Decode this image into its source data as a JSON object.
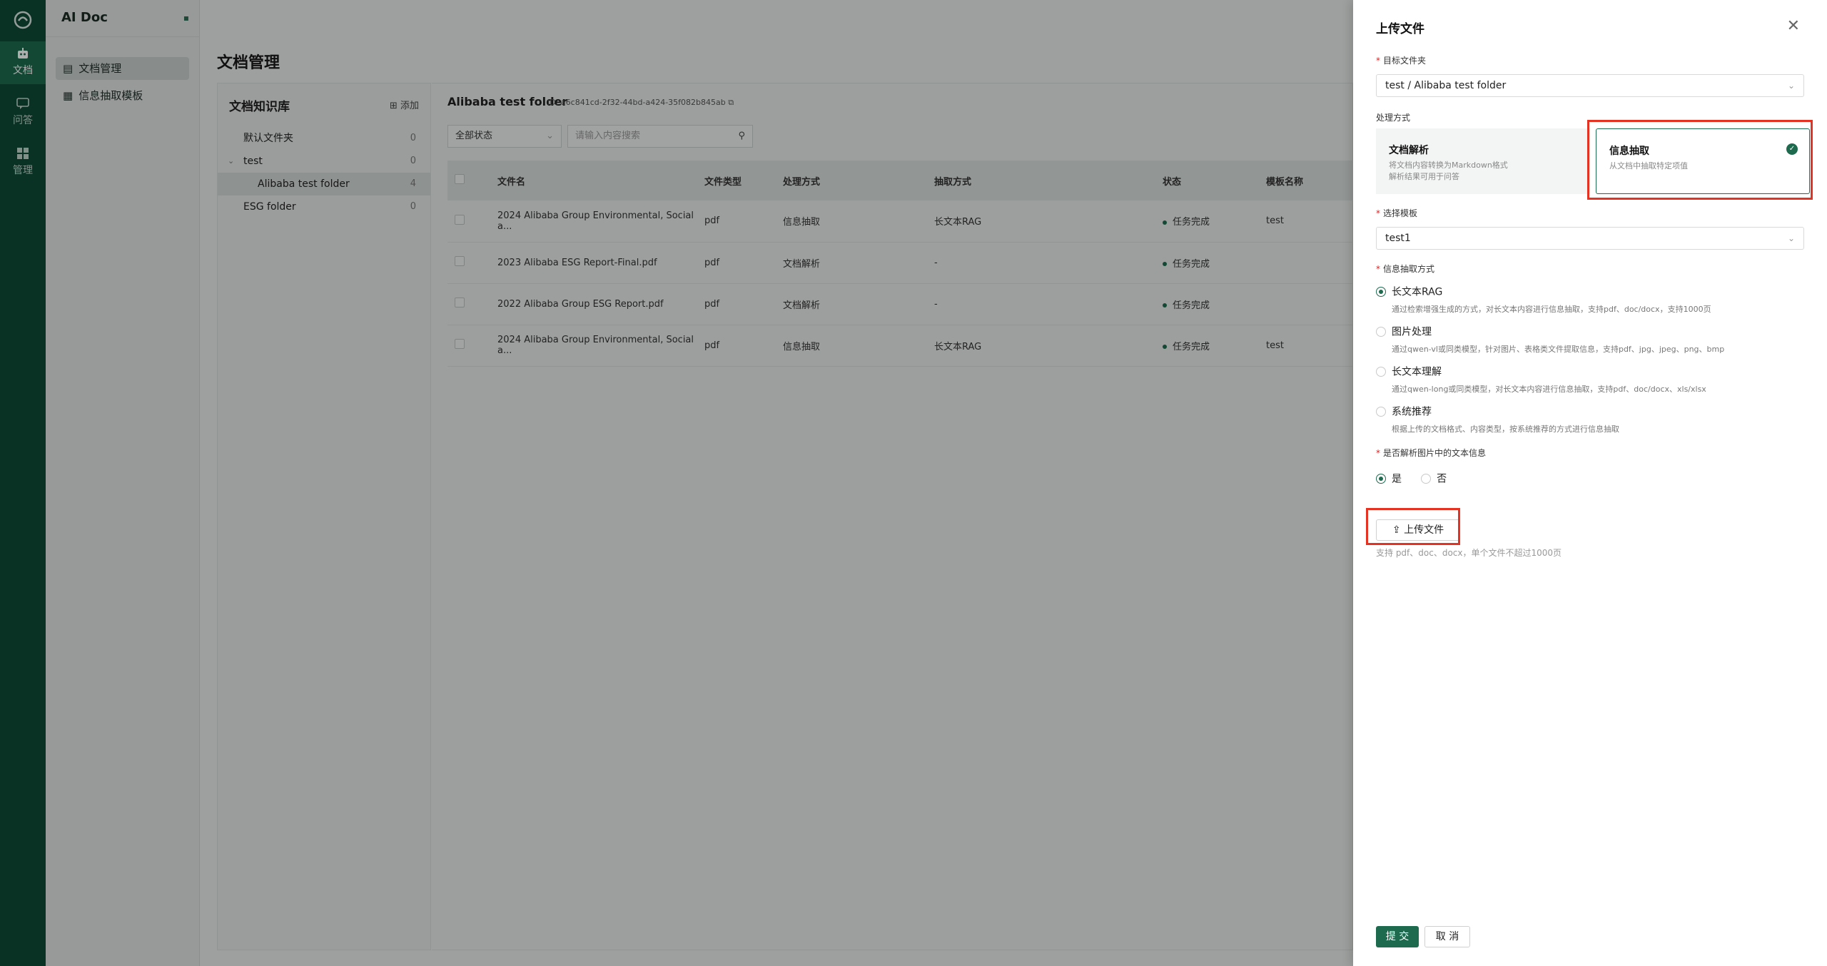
{
  "app": {
    "title": "AI Doc"
  },
  "rail": [
    {
      "label": "文档",
      "icon": "robot-icon"
    },
    {
      "label": "问答",
      "icon": "chat-icon"
    },
    {
      "label": "管理",
      "icon": "grid-icon"
    }
  ],
  "sidebar": {
    "items": [
      {
        "label": "文档管理"
      },
      {
        "label": "信息抽取模板"
      }
    ]
  },
  "page": {
    "title": "文档管理"
  },
  "kb": {
    "title": "文档知识库",
    "add_label": "添加",
    "tree": [
      {
        "label": "默认文件夹",
        "count": "0"
      },
      {
        "label": "test",
        "count": "0"
      },
      {
        "label": "Alibaba test folder",
        "count": "4"
      },
      {
        "label": "ESG folder",
        "count": "0"
      }
    ]
  },
  "folder": {
    "title": "Alibaba test folder",
    "id_text": "ID: a6c841cd-2f32-44bd-a424-35f082b845ab",
    "status_filter": "全部状态",
    "search_placeholder": "请输入内容搜索"
  },
  "table": {
    "headers": [
      "文件名",
      "文件类型",
      "处理方式",
      "抽取方式",
      "状态",
      "模板名称"
    ],
    "rows": [
      [
        "2024 Alibaba Group Environmental, Social a...",
        "pdf",
        "信息抽取",
        "长文本RAG",
        "任务完成",
        "test"
      ],
      [
        "2023 Alibaba ESG Report-Final.pdf",
        "pdf",
        "文档解析",
        "-",
        "任务完成",
        ""
      ],
      [
        "2022 Alibaba Group ESG Report.pdf",
        "pdf",
        "文档解析",
        "-",
        "任务完成",
        ""
      ],
      [
        "2024 Alibaba Group Environmental, Social a...",
        "pdf",
        "信息抽取",
        "长文本RAG",
        "任务完成",
        "test"
      ]
    ]
  },
  "drawer": {
    "title": "上传文件",
    "target_label": "目标文件夹",
    "target_value": "test / Alibaba test folder",
    "method_label": "处理方式",
    "method_options": [
      {
        "title": "文档解析",
        "desc1": "将文档内容转换为Markdown格式",
        "desc2": "解析结果可用于问答"
      },
      {
        "title": "信息抽取",
        "desc1": "从文档中抽取特定项值",
        "desc2": ""
      }
    ],
    "template_label": "选择模板",
    "template_value": "test1",
    "extract_label": "信息抽取方式",
    "extract_options": [
      {
        "title": "长文本RAG",
        "desc": "通过检索增强生成的方式，对长文本内容进行信息抽取，支持pdf、doc/docx，支持1000页"
      },
      {
        "title": "图片处理",
        "desc": "通过qwen-vl或同类模型，针对图片、表格类文件提取信息，支持pdf、jpg、jpeg、png、bmp"
      },
      {
        "title": "长文本理解",
        "desc": "通过qwen-long或同类模型，对长文本内容进行信息抽取，支持pdf、doc/docx、xls/xlsx"
      },
      {
        "title": "系统推荐",
        "desc": "根据上传的文档格式、内容类型，按系统推荐的方式进行信息抽取"
      }
    ],
    "parse_label": "是否解析图片中的文本信息",
    "parse_yes": "是",
    "parse_no": "否",
    "upload_button": "上传文件",
    "upload_hint": "支持 pdf、doc、docx，单个文件不超过1000页",
    "submit": "提 交",
    "cancel": "取 消"
  },
  "colors": {
    "primary": "#1d6a4f",
    "highlight": "#e53323",
    "rail": "#0f4a36"
  }
}
